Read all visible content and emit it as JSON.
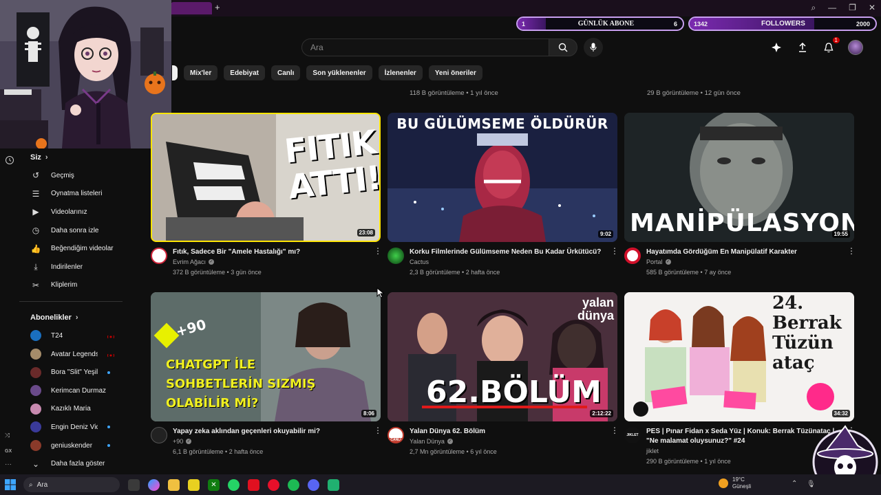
{
  "overlay": {
    "daily_subs": {
      "left": "1",
      "label": "GÜNLÜK ABONE",
      "right": "6",
      "progress": 0.17
    },
    "followers": {
      "left": "1342",
      "label": "FOLLOWERS",
      "right": "2000",
      "progress": 0.67
    }
  },
  "header": {
    "search_placeholder": "Ara",
    "notifications_count": "1"
  },
  "chips": [
    "Mix'ler",
    "Edebiyat",
    "Canlı",
    "Son yüklenenler",
    "İzlenenler",
    "Yeni öneriler"
  ],
  "previous_row_meta": [
    {
      "stats": "118 B görüntüleme • 1 yıl önce"
    },
    {
      "stats": "29 B görüntüleme • 12 gün önce"
    }
  ],
  "sidebar": {
    "you_title": "Siz",
    "you_items": [
      {
        "icon": "history-icon",
        "label": "Geçmiş"
      },
      {
        "icon": "playlists-icon",
        "label": "Oynatma listeleri"
      },
      {
        "icon": "your-videos-icon",
        "label": "Videolarınız"
      },
      {
        "icon": "watch-later-icon",
        "label": "Daha sonra izle"
      },
      {
        "icon": "liked-videos-icon",
        "label": "Beğendiğim videolar"
      },
      {
        "icon": "downloads-icon",
        "label": "İndirilenler"
      },
      {
        "icon": "clips-icon",
        "label": "Kliplerim"
      }
    ],
    "subs_title": "Abonelikler",
    "subscriptions": [
      {
        "name": "T24",
        "color": "#1a6fbf",
        "status": "live"
      },
      {
        "name": "Avatar Legends",
        "color": "#a58c6a",
        "status": "live"
      },
      {
        "name": "Bora \"Slit\" Yeşilir...",
        "color": "#6a2a2a",
        "status": "new"
      },
      {
        "name": "Kerimcan Durmaz",
        "color": "#6a4a8a",
        "status": "none"
      },
      {
        "name": "Kazıklı Maria",
        "color": "#c88ab0",
        "status": "none"
      },
      {
        "name": "Engin Deniz Vide...",
        "color": "#3a3a9a",
        "status": "new"
      },
      {
        "name": "geniuskender",
        "color": "#8a3a2a",
        "status": "new"
      }
    ],
    "show_more": "Daha fazla göster"
  },
  "videos": [
    {
      "title": "Fıtık, Sadece Bir \"Amele Hastalığı\" mı?",
      "channel": "Evrim Ağacı",
      "verified": true,
      "stats": "372 B görüntüleme • 3 gün önce",
      "duration": "23:08",
      "thumb_text": "FITIK ATTI!",
      "avatar_color": "#ffffff"
    },
    {
      "title": "Korku Filmlerinde Gülümseme Neden Bu Kadar Ürkütücü?",
      "channel": "Cactus",
      "verified": false,
      "stats": "2,3 B görüntüleme • 2 hafta önce",
      "duration": "9:02",
      "thumb_text": "BU GÜLÜMSEME ÖLDÜRÜR",
      "avatar_color": "#1a7a2a"
    },
    {
      "title": "Hayatımda Gördüğüm En Manipülatif Karakter",
      "channel": "Portal",
      "verified": true,
      "stats": "585 B görüntüleme • 7 ay önce",
      "duration": "19:55",
      "thumb_text": "MANİPÜLASYON",
      "avatar_color": "#ffffff"
    },
    {
      "title": "Yapay zeka aklından geçenleri okuyabilir mi?",
      "channel": "+90",
      "verified": true,
      "stats": "6,1 B görüntüleme • 2 hafta önce",
      "duration": "8:06",
      "thumb_text": "CHATGPT İLE SOHBETLERİN SIZMIŞ OLABİLİR Mİ?",
      "thumb_badge": "+90",
      "avatar_color": "#222222"
    },
    {
      "title": "Yalan Dünya 62. Bölüm",
      "channel": "Yalan Dünya",
      "verified": true,
      "stats": "2,7 Mn görüntüleme • 6 yıl önce",
      "duration": "2:12:22",
      "thumb_text": "62.BÖLÜM",
      "thumb_logo": "yalan dünya",
      "avatar_color": "#c0392b",
      "avatar_label": "CANLI"
    },
    {
      "title": "PES | Pınar Fidan x Seda Yüz | Konuk: Berrak Tüzünataç | \"Ne malamat oluysunuz?\" #24",
      "channel": "jiklet",
      "verified": false,
      "stats": "290 B görüntüleme • 1 yıl önce",
      "duration": "34:32",
      "thumb_text": "24. Berrak Tüzün ataç",
      "avatar_color": "#111111",
      "avatar_label": "JIKLET"
    }
  ],
  "taskbar": {
    "search": "Ara",
    "weather_temp": "19°C",
    "weather_desc": "Güneşli"
  },
  "colors": {
    "background": "#0f0f0f",
    "accent_purple": "#7b2ab0",
    "live_red": "#cc0000"
  }
}
